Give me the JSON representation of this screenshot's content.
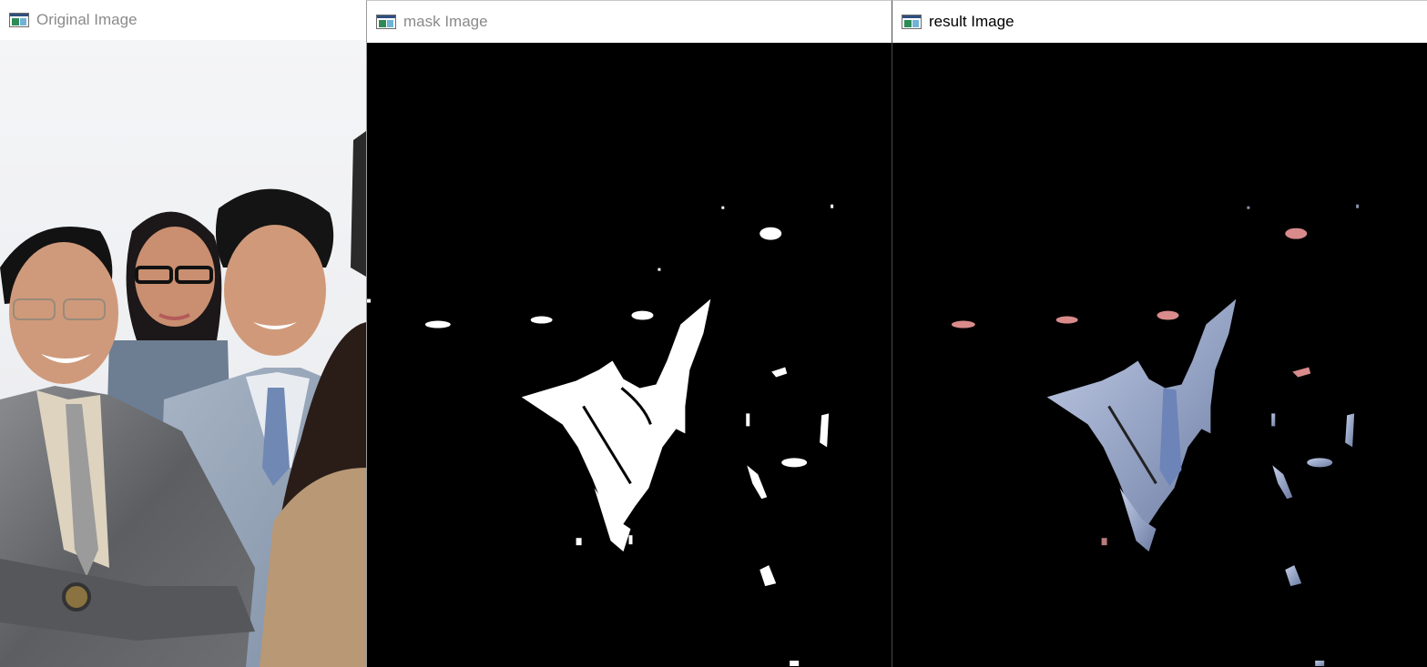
{
  "windows": {
    "original": {
      "title": "Original Image",
      "icon": "opencv-window-icon",
      "state": "inactive"
    },
    "mask": {
      "title": "mask Image",
      "icon": "opencv-window-icon",
      "state": "inactive"
    },
    "result": {
      "title": "result Image",
      "icon": "opencv-window-icon",
      "state": "active"
    }
  },
  "colors": {
    "photo_background": "#f2f3f5",
    "mask_fill": "#ffffff",
    "result_suit": "#a9b6d6",
    "result_lips": "#d98a8a",
    "canvas": "#000000"
  }
}
